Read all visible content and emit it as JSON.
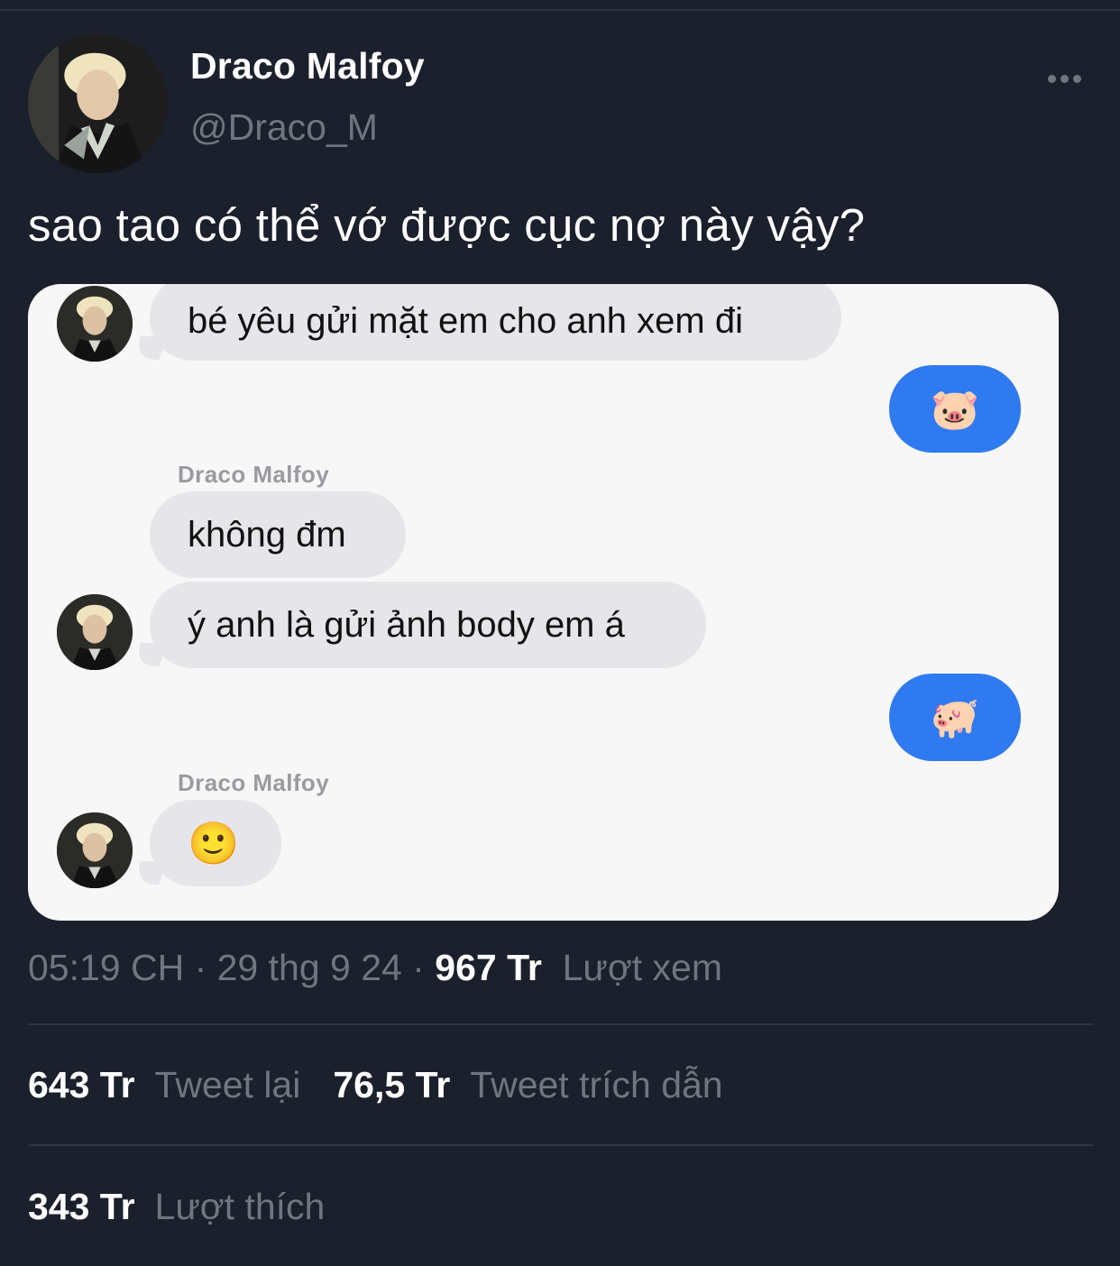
{
  "author": {
    "name": "Draco Malfoy",
    "handle": "@Draco_M"
  },
  "tweet": {
    "text": "sao tao có thể vớ được cục nợ này vậy?"
  },
  "chat": {
    "messages": [
      {
        "type": "incoming",
        "text": "bé yêu gửi mặt em cho anh xem đi"
      },
      {
        "type": "outgoing",
        "text": "🐷"
      },
      {
        "type": "sender",
        "text": "Draco Malfoy"
      },
      {
        "type": "incoming",
        "text": "không đm"
      },
      {
        "type": "incoming",
        "text": "ý anh là gửi ảnh body em á"
      },
      {
        "type": "outgoing",
        "text": "🐖"
      },
      {
        "type": "sender",
        "text": "Draco Malfoy"
      },
      {
        "type": "incoming",
        "text": "🙂"
      }
    ]
  },
  "meta": {
    "time": "05:19 CH",
    "sep1": " · ",
    "date": "29 thg 9 24",
    "sep2": " · ",
    "views_count": "967 Tr",
    "views_label": "Lượt xem"
  },
  "stats": {
    "retweets_count": "643 Tr",
    "retweets_label": "Tweet lại",
    "quotes_count": "76,5 Tr",
    "quotes_label": "Tweet trích dẫn",
    "likes_count": "343 Tr",
    "likes_label": "Lượt thích"
  },
  "icons": {
    "more": "more-horizontal-icon"
  },
  "colors": {
    "background": "#1a202c",
    "outgoing_bubble": "#2f7af0",
    "incoming_bubble": "#e6e6ea",
    "muted_text": "#6e7781"
  }
}
